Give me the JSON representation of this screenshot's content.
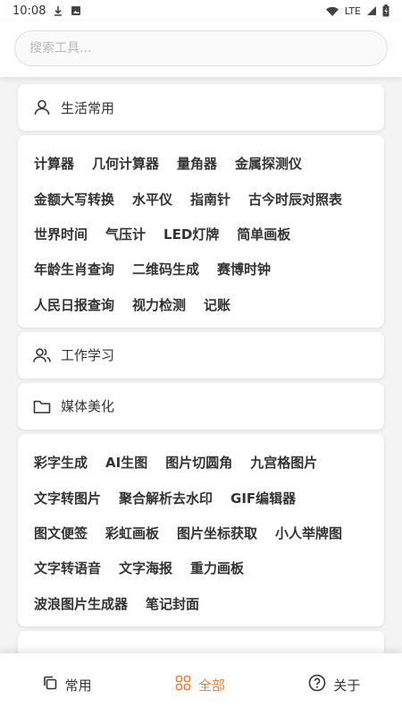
{
  "status_bar": {
    "time": "10:08",
    "network": "LTE"
  },
  "search": {
    "placeholder": "搜索工具..."
  },
  "sections": [
    {
      "title": "生活常用",
      "icon": "person-icon",
      "rows": [
        [
          "计算器",
          "几何计算器",
          "量角器",
          "金属探测仪"
        ],
        [
          "金额大写转换",
          "水平仪",
          "指南针",
          "古今时辰对照表"
        ],
        [
          "世界时间",
          "气压计",
          "LED灯牌",
          "简单画板"
        ],
        [
          "年龄生肖查询",
          "二维码生成",
          "赛博时钟"
        ],
        [
          "人民日报查询",
          "视力检测",
          "记账"
        ]
      ]
    },
    {
      "title": "工作学习",
      "icon": "people-icon"
    },
    {
      "title": "媒体美化",
      "icon": "folder-icon",
      "rows": [
        [
          "彩字生成",
          "AI生图",
          "图片切圆角",
          "九宫格图片"
        ],
        [
          "文字转图片",
          "聚合解析去水印",
          "GIF编辑器"
        ],
        [
          "图文便签",
          "彩虹画板",
          "图片坐标获取",
          "小人举牌图"
        ],
        [
          "文字转语音",
          "文字海报",
          "重力画板"
        ],
        [
          "波浪图片生成器",
          "笔记封面"
        ]
      ]
    }
  ],
  "bottom_nav": {
    "common": "常用",
    "all": "全部",
    "about": "关于",
    "active_color": "#f0803c"
  }
}
